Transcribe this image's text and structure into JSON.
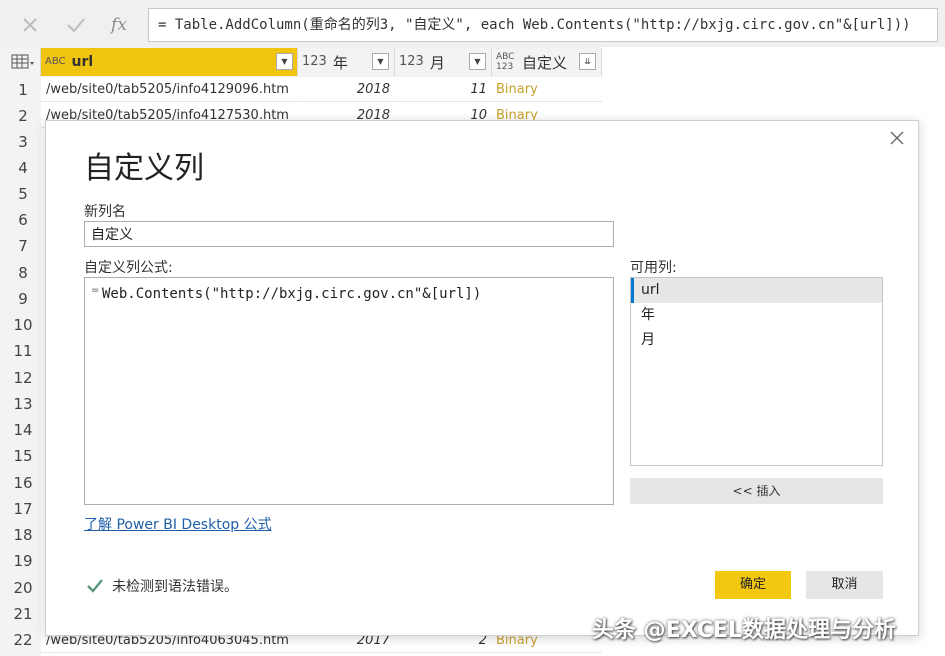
{
  "formula_bar": {
    "fx_label": "fx",
    "formula": "= Table.AddColumn(重命名的列3, \"自定义\", each Web.Contents(\"http://bxjg.circ.gov.cn\"&[url]))"
  },
  "table": {
    "columns": [
      {
        "type_label": "ABC",
        "name": "url"
      },
      {
        "type_label": "123",
        "name": "年"
      },
      {
        "type_label": "123",
        "name": "月"
      },
      {
        "type_label": "ABC 123",
        "name": "自定义"
      }
    ],
    "row_numbers": [
      "1",
      "2",
      "3",
      "4",
      "5",
      "6",
      "7",
      "8",
      "9",
      "10",
      "11",
      "12",
      "13",
      "14",
      "15",
      "16",
      "17",
      "18",
      "19",
      "20",
      "21",
      "22"
    ],
    "visible_rows": [
      {
        "num": "1",
        "url": "/web/site0/tab5205/info4129096.htm",
        "year": "2018",
        "month": "11",
        "custom": "Binary"
      },
      {
        "num": "2",
        "url": "/web/site0/tab5205/info4127530.htm",
        "year": "2018",
        "month": "10",
        "custom": "Binary"
      },
      {
        "num": "22",
        "url": "/web/site0/tab5205/info4063045.htm",
        "year": "2017",
        "month": "2",
        "custom": "Binary"
      }
    ]
  },
  "dialog": {
    "title": "自定义列",
    "new_column_label": "新列名",
    "new_column_value": "自定义",
    "formula_label": "自定义列公式:",
    "formula_eq": "=",
    "formula": "Web.Contents(\"http://bxjg.circ.gov.cn\"&[url])",
    "available_label": "可用列:",
    "available_columns": [
      "url",
      "年",
      "月"
    ],
    "selected_available": "url",
    "insert_button": "<< 插入",
    "learn_link": "了解 Power BI Desktop 公式",
    "status_text": "未检测到语法错误。",
    "ok_button": "确定",
    "cancel_button": "取消"
  },
  "watermark": "头条 @EXCEL数据处理与分析",
  "colors": {
    "accent_yellow": "#f2c811",
    "link_blue": "#1f5fa8",
    "binary_text": "#c8a12b",
    "check_green": "#5a9a7a"
  }
}
